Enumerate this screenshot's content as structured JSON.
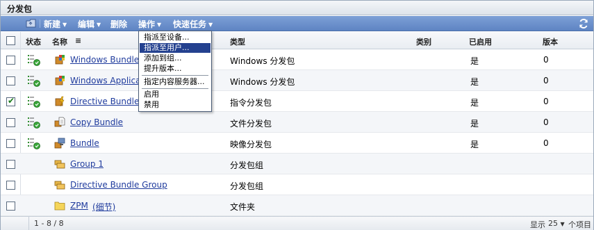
{
  "panel": {
    "title": "分发包"
  },
  "toolbar": {
    "new_label": "新建",
    "edit_label": "编辑",
    "delete_label": "删除",
    "actions_label": "操作",
    "quick_tasks_label": "快速任务",
    "caret": "▼",
    "refresh_icon": "refresh-icon",
    "folder_icon": "folder-up-icon"
  },
  "actions_menu": {
    "items": [
      {
        "label": "指派至设备..."
      },
      {
        "label": "指派至用户..."
      },
      {
        "label": "添加到组..."
      },
      {
        "label": "提升版本..."
      },
      {
        "label": "指定内容服务器..."
      },
      {
        "label": "启用"
      },
      {
        "label": "禁用"
      }
    ],
    "highlighted_index": 1
  },
  "table": {
    "columns": {
      "status": "状态",
      "name": "名称",
      "sort_icon": "≡",
      "type": "类型",
      "category": "类别",
      "enabled": "已启用",
      "version": "版本"
    },
    "rows": [
      {
        "checked": false,
        "status_icon": "deployed-status-icon",
        "icon": "windows-bundle-icon",
        "name": "Windows Bundle",
        "type": "Windows 分发包",
        "category": "",
        "enabled": "是",
        "version": "0"
      },
      {
        "checked": false,
        "status_icon": "deployed-status-icon",
        "icon": "windows-bundle-icon",
        "name": "Windows Applica",
        "type": "Windows 分发包",
        "category": "",
        "enabled": "是",
        "version": "0"
      },
      {
        "checked": true,
        "status_icon": "deployed-status-icon",
        "icon": "directive-bundle-icon",
        "name": "Directive Bundle",
        "type": "指令分发包",
        "category": "",
        "enabled": "是",
        "version": "0"
      },
      {
        "checked": false,
        "status_icon": "deployed-status-icon",
        "icon": "file-bundle-icon",
        "name": "Copy Bundle",
        "type": "文件分发包",
        "category": "",
        "enabled": "是",
        "version": "0"
      },
      {
        "checked": false,
        "status_icon": "deployed-status-icon",
        "icon": "image-bundle-icon",
        "name": "Bundle",
        "type": "映像分发包",
        "category": "",
        "enabled": "是",
        "version": "0"
      },
      {
        "checked": false,
        "status_icon": "",
        "icon": "bundle-group-icon",
        "name": "Group 1",
        "type": "分发包组",
        "category": "",
        "enabled": "",
        "version": ""
      },
      {
        "checked": false,
        "status_icon": "",
        "icon": "bundle-group-icon",
        "name": "Directive Bundle Group",
        "type": "分发包组",
        "category": "",
        "enabled": "",
        "version": ""
      },
      {
        "checked": false,
        "status_icon": "",
        "icon": "folder-icon",
        "name": "ZPM",
        "name_extra": "(细节)",
        "type": "文件夹",
        "category": "",
        "enabled": "",
        "version": ""
      }
    ]
  },
  "footer": {
    "range": "1 - 8 / 8",
    "show_label": "显示",
    "page_size": "25",
    "caret": "▼",
    "per_page_label": "个项目"
  }
}
